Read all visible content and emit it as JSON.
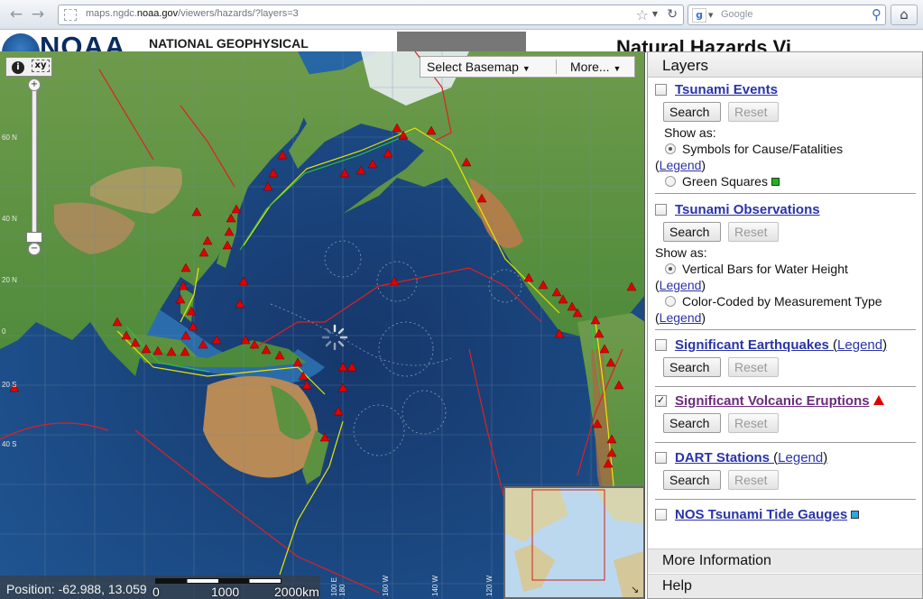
{
  "browser": {
    "url_prefix": "maps.ngdc.",
    "url_domain": "noaa.gov",
    "url_suffix": "/viewers/hazards/?layers=3",
    "search_placeholder": "Google",
    "icons": [
      "back-icon",
      "forward-icon",
      "bookmark-star-icon",
      "reload-icon",
      "google-icon",
      "magnifier-icon",
      "home-icon"
    ]
  },
  "page_header": {
    "logo_text": "NOAA",
    "org_text": "NATIONAL GEOPHYSICAL",
    "viewer_title": "Natural Hazards Vi"
  },
  "map": {
    "basemap_button": "Select Basemap",
    "more_button": "More...",
    "position_label": "Position: -62.988, 13.059",
    "scale_labels": [
      "0",
      "1000",
      "2000km"
    ],
    "lat_labels": [
      "60 N",
      "40 N",
      "20 N",
      "0",
      "20 S",
      "40 S"
    ],
    "lon_labels": [
      "100 E",
      "180",
      "160 W",
      "140 W",
      "120 W"
    ],
    "tool_labels": {
      "info": "i",
      "xy": "xy"
    },
    "marker_color": "#e10000",
    "plate_boundary_color": "#e02020",
    "trench_color": "#e8e800"
  },
  "layers_panel": {
    "title": "Layers",
    "search_label": "Search",
    "reset_label": "Reset",
    "legend_label": "Legend",
    "show_as_label": "Show as:",
    "tsunami_events": {
      "name": "Tsunami Events",
      "checked": false,
      "options": [
        "Symbols for Cause/Fatalities",
        "Green Squares"
      ]
    },
    "tsunami_observations": {
      "name": "Tsunami Observations",
      "checked": false,
      "options": [
        "Vertical Bars for Water Height",
        "Color-Coded by Measurement Type"
      ]
    },
    "earthquakes": {
      "name": "Significant Earthquakes",
      "checked": false
    },
    "volcanoes": {
      "name": "Significant Volcanic Eruptions",
      "checked": true,
      "symbol_color": "#e10000"
    },
    "dart": {
      "name": "DART Stations",
      "checked": false
    },
    "tide_gauges": {
      "name": "NOS Tsunami Tide Gauges",
      "checked": false,
      "symbol_color": "#2ea7dd"
    },
    "footer": [
      "More Information",
      "Help"
    ]
  }
}
